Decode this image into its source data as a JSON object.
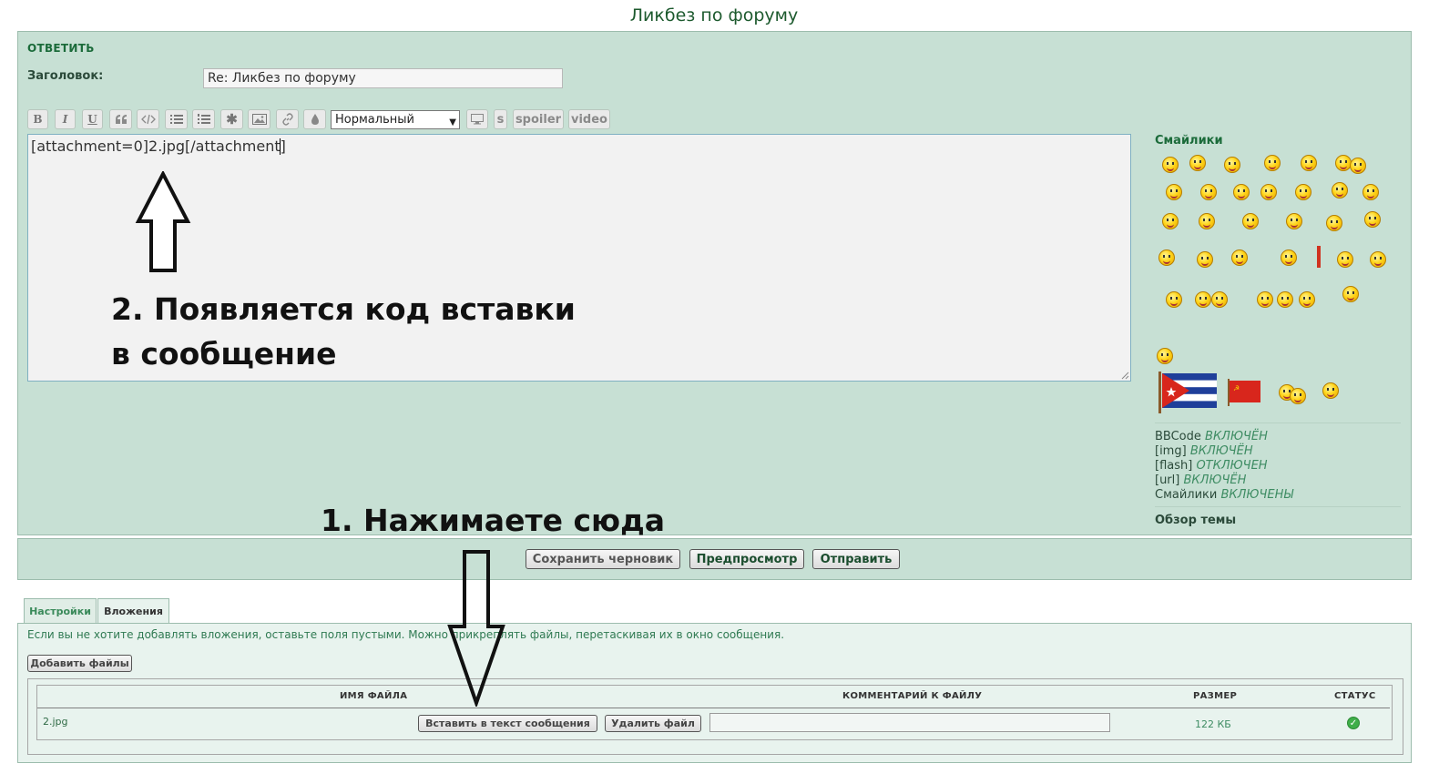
{
  "page": {
    "title": "Ликбез по форуму"
  },
  "reply": {
    "heading": "ОТВЕТИТЬ",
    "subject_label": "Заголовок:",
    "subject_value": "Re: Ликбез по форуму"
  },
  "toolbar": {
    "bold": "B",
    "italic": "I",
    "underline": "U",
    "quote_icon": "quote-icon",
    "code_icon": "code-icon",
    "list_icon": "list-icon",
    "list_numbered_icon": "numbered-list-icon",
    "list_item_icon": "asterisk-icon",
    "image_icon": "image-icon",
    "link_icon": "link-icon",
    "color_icon": "drop-icon",
    "font_size": "Нормальный",
    "monitor_icon": "monitor-icon",
    "strike": "s",
    "spoiler": "spoiler",
    "video": "video"
  },
  "editor": {
    "content": "[attachment=0]2.jpg[/attachment]"
  },
  "annotations": {
    "step2_line1": "2. Появляется код вставки",
    "step2_line2": "в сообщение",
    "step1": "1. Нажимаете сюда"
  },
  "sidebar": {
    "smilies_heading": "Смайлики",
    "flag_icons": [
      "cuba-flag-icon",
      "ussr-flag-icon"
    ],
    "status": [
      {
        "name": "BBCode",
        "state": "ВКЛЮЧЁН"
      },
      {
        "name": "[img]",
        "state": "ВКЛЮЧЁН"
      },
      {
        "name": "[flash]",
        "state": "ОТКЛЮЧЕН"
      },
      {
        "name": "[url]",
        "state": "ВКЛЮЧЁН"
      },
      {
        "name": "Смайлики",
        "state": "ВКЛЮЧЕНЫ"
      }
    ],
    "topic_review": "Обзор темы"
  },
  "actions": {
    "save_draft": "Сохранить черновик",
    "preview": "Предпросмотр",
    "submit": "Отправить"
  },
  "tabs": [
    {
      "label": "Настройки",
      "active": false
    },
    {
      "label": "Вложения",
      "active": true
    }
  ],
  "attachments": {
    "hint": "Если вы не хотите добавлять вложения, оставьте поля пустыми. Можно прикреплять файлы, перетаскивая их в окно сообщения.",
    "add_files": "Добавить файлы",
    "columns": [
      "ИМЯ ФАЙЛА",
      "КОММЕНТАРИЙ К ФАЙЛУ",
      "РАЗМЕР",
      "СТАТУС"
    ],
    "rows": [
      {
        "filename": "2.jpg",
        "insert_label": "Вставить в текст сообщения",
        "delete_label": "Удалить файл",
        "comment": "",
        "size": "122 КБ",
        "status_icon": "success-check-icon"
      }
    ]
  },
  "colors": {
    "panel": "#c7e0d4",
    "accent": "#1b6b3a",
    "status_ok": "#3fae49"
  }
}
